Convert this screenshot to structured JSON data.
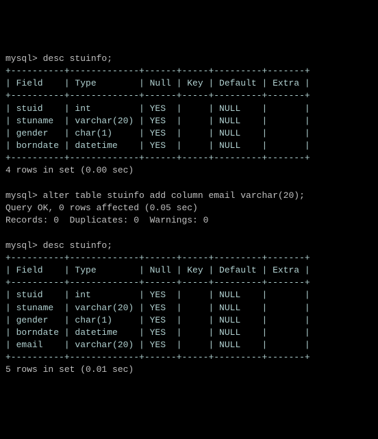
{
  "prompt": "mysql>",
  "cmd1": "desc stuinfo;",
  "cmd2": "alter table stuinfo add column email varchar(20);",
  "cmd3": "desc stuinfo;",
  "hr_top": "+----------+-------------+------+-----+---------+-------+",
  "hr_header": "+----------+-------------+------+-----+---------+-------+",
  "hr_bottom": "+----------+-------------+------+-----+---------+-------+",
  "header_row": "| Field    | Type        | Null | Key | Default | Extra |",
  "table1_rows": [
    "| stuid    | int         | YES  |     | NULL    |       |",
    "| stuname  | varchar(20) | YES  |     | NULL    |       |",
    "| gender   | char(1)     | YES  |     | NULL    |       |",
    "| borndate | datetime    | YES  |     | NULL    |       |"
  ],
  "table1_summary": "4 rows in set (0.00 sec)",
  "alter_result_line1": "Query OK, 0 rows affected (0.05 sec)",
  "alter_result_line2": "Records: 0  Duplicates: 0  Warnings: 0",
  "table2_rows": [
    "| stuid    | int         | YES  |     | NULL    |       |",
    "| stuname  | varchar(20) | YES  |     | NULL    |       |",
    "| gender   | char(1)     | YES  |     | NULL    |       |",
    "| borndate | datetime    | YES  |     | NULL    |       |",
    "| email    | varchar(20) | YES  |     | NULL    |       |"
  ],
  "table2_summary": "5 rows in set (0.01 sec)"
}
